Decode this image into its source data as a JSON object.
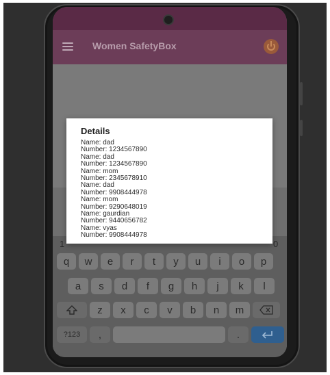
{
  "app": {
    "title": "Women SafetyBox"
  },
  "dialog": {
    "title": "Details",
    "lines": [
      "Name: dad",
      "Number: 1234567890",
      "Name: dad",
      "Number: 1234567890",
      "Name: mom",
      "Number: 2345678910",
      "Name: dad",
      "Number: 9908444978",
      "Name: mom",
      "Number: 9290648019",
      "Name: gaurdian",
      "Number: 9440656782",
      "Name: vyas",
      "Number: 9908444978"
    ]
  },
  "keyboard": {
    "row_numbers": [
      "1",
      "0"
    ],
    "row1": [
      "q",
      "w",
      "e",
      "r",
      "t",
      "y",
      "u",
      "i",
      "o",
      "p"
    ],
    "row2": [
      "a",
      "s",
      "d",
      "f",
      "g",
      "h",
      "j",
      "k",
      "l"
    ],
    "row3": [
      "z",
      "x",
      "c",
      "v",
      "b",
      "n",
      "m"
    ],
    "shift_icon": "shift-icon",
    "backspace_icon": "backspace-icon",
    "symbols_label": "?123",
    "comma_label": ",",
    "period_label": ".",
    "enter_icon": "enter-icon"
  },
  "colors": {
    "statusbar": "#5a2a46",
    "appbar": "#6c3d58",
    "enter_key": "#2f5f8f"
  }
}
